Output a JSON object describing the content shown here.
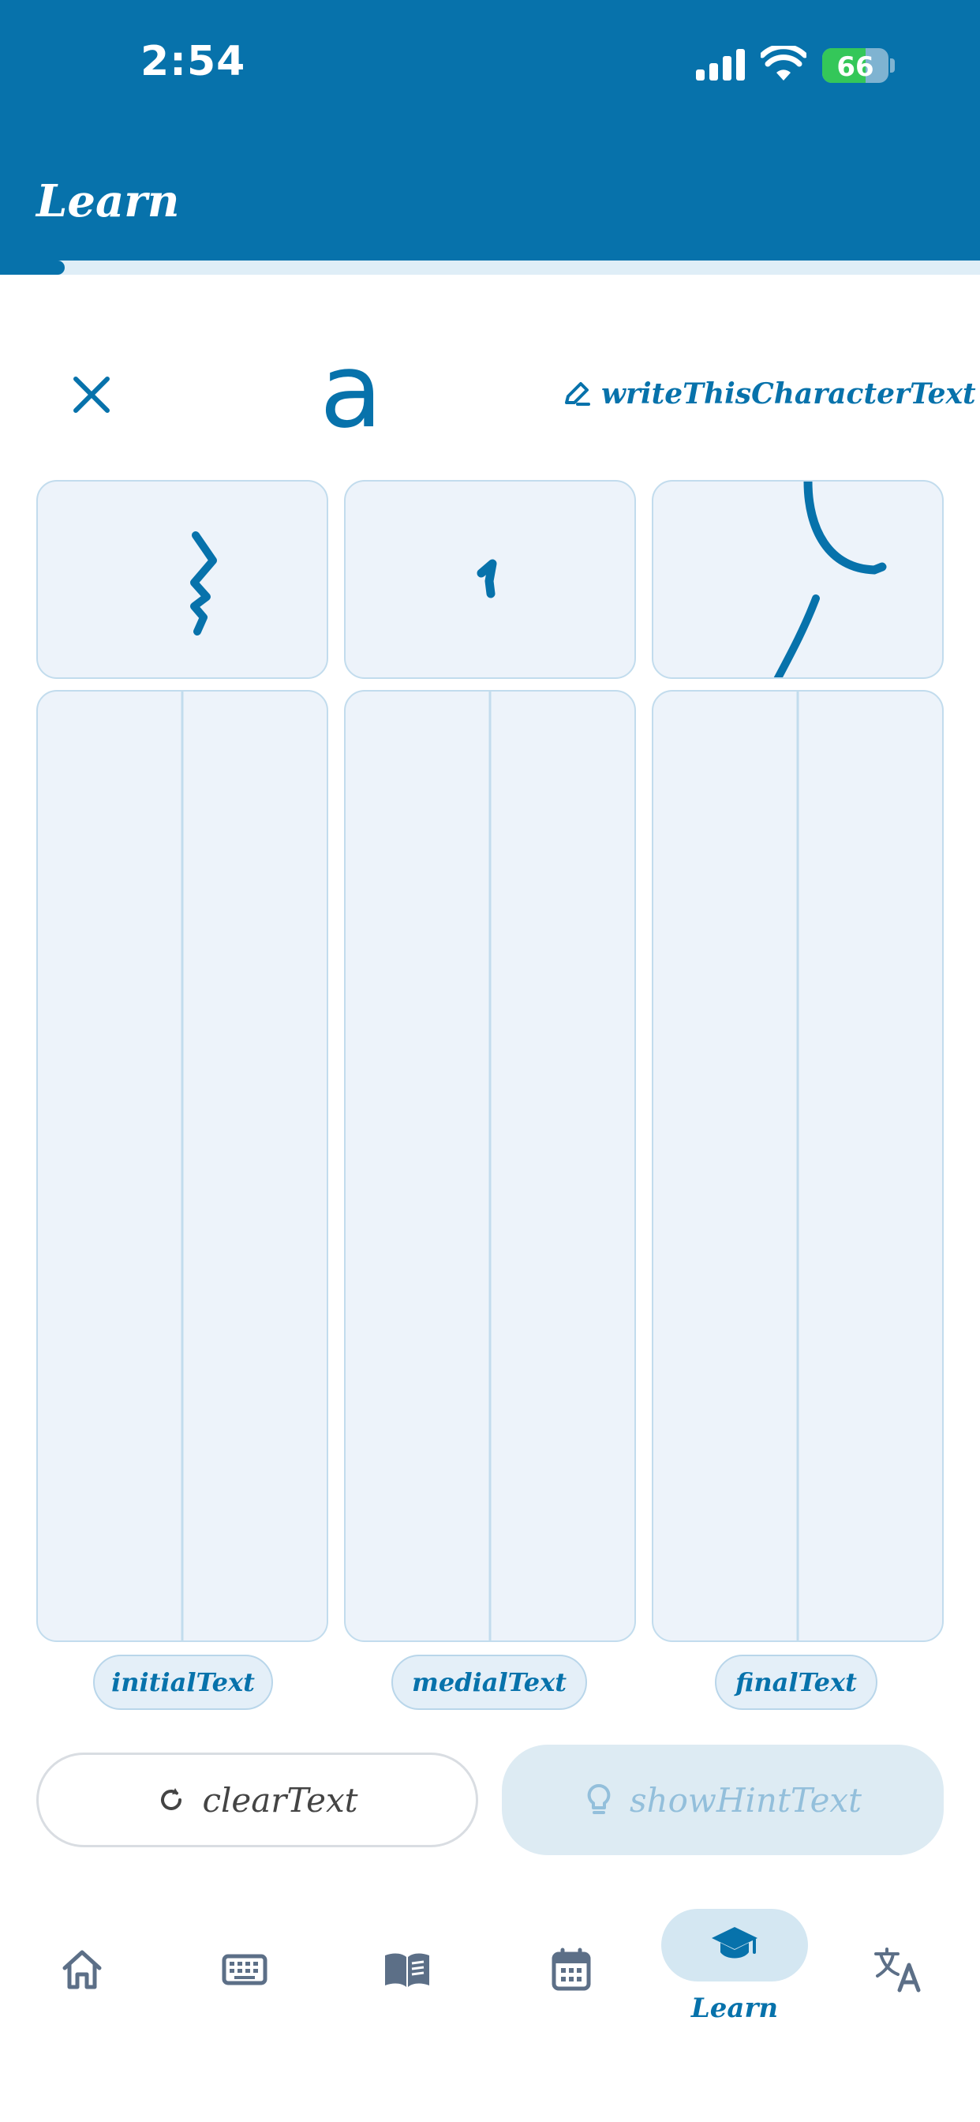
{
  "status_bar": {
    "time": "2:54",
    "battery": "66",
    "battery_level": 0.66
  },
  "header": {
    "title": "Learn",
    "progress": 0.065
  },
  "character": {
    "display": "a",
    "write_hint_label": "writeThisCharacterText",
    "forms": [
      {
        "label": "initialText"
      },
      {
        "label": "medialText"
      },
      {
        "label": "finalText"
      }
    ]
  },
  "actions": {
    "clear_label": "clearText",
    "hint_label": "showHintText"
  },
  "bottom_nav": {
    "items": [
      {
        "icon": "home-icon"
      },
      {
        "icon": "keyboard-icon"
      },
      {
        "icon": "book-icon"
      },
      {
        "icon": "calendar-icon"
      },
      {
        "icon": "graduation-cap-icon",
        "label": "Learn",
        "active": true
      },
      {
        "icon": "translate-icon"
      }
    ]
  },
  "colors": {
    "primary": "#0772ab",
    "panel_bg": "#edf3fa",
    "panel_border": "#c2dced"
  }
}
